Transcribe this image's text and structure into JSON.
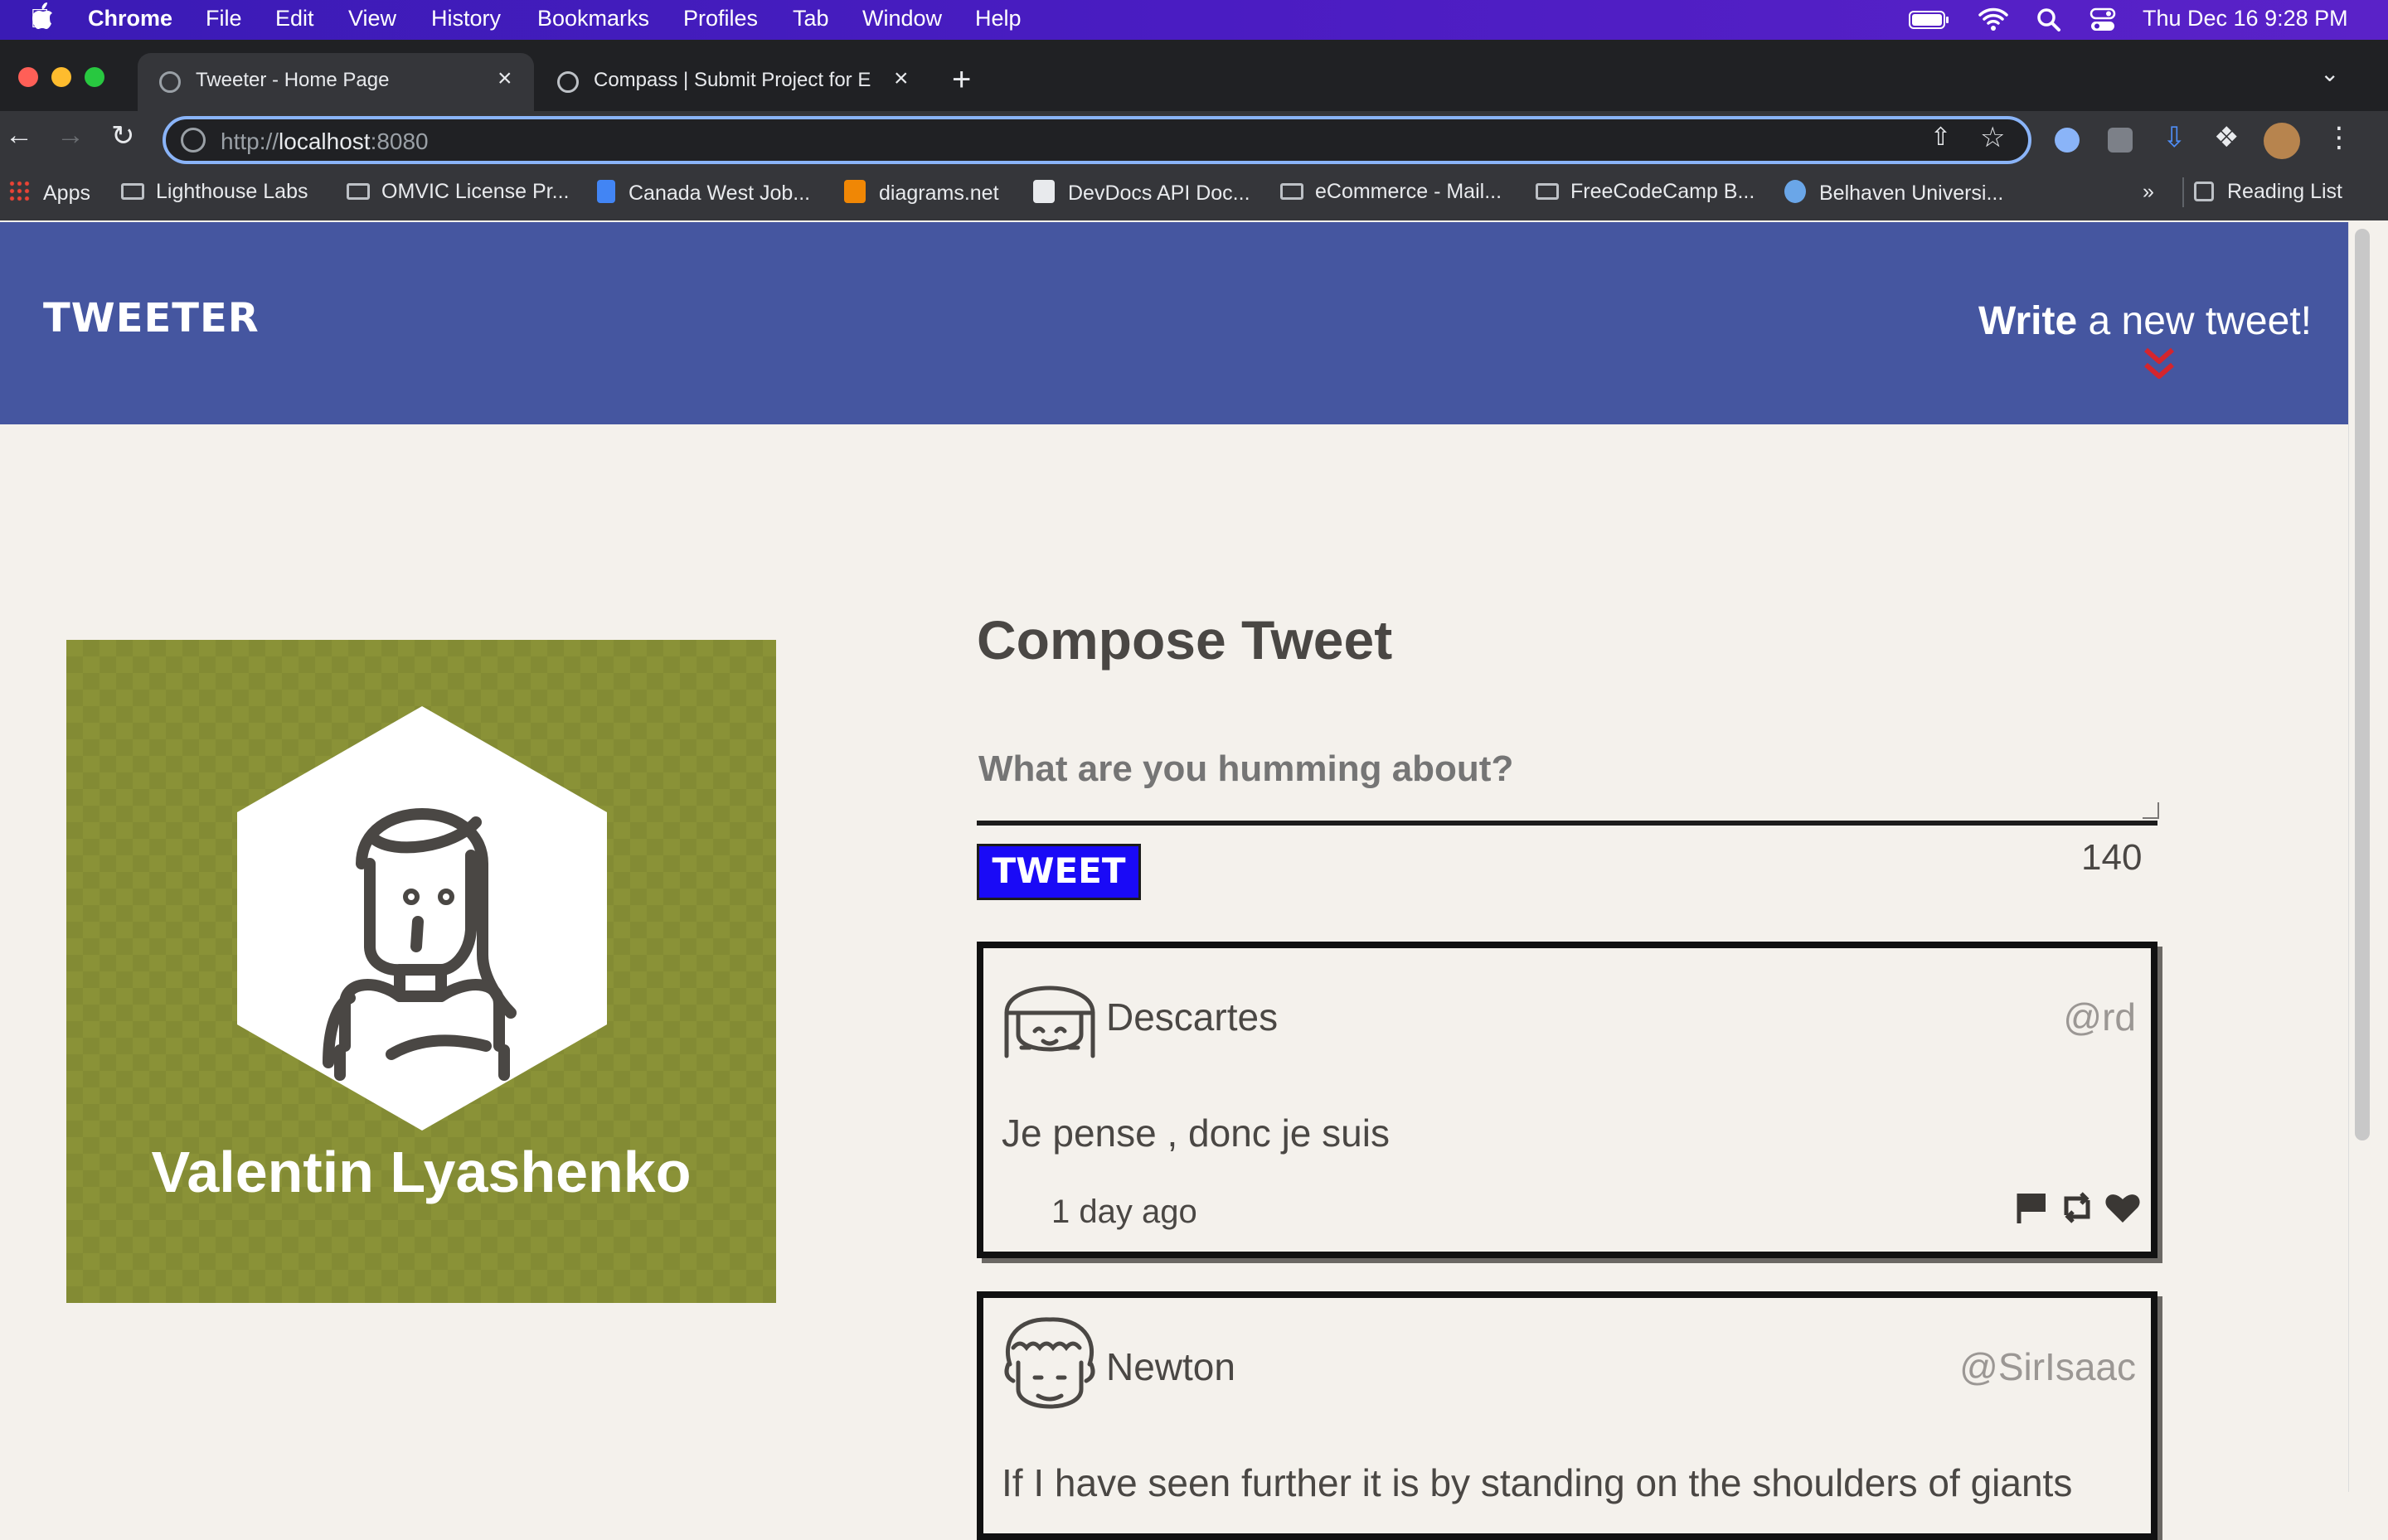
{
  "menubar": {
    "app": "Chrome",
    "items": [
      "File",
      "Edit",
      "View",
      "History",
      "Bookmarks",
      "Profiles",
      "Tab",
      "Window",
      "Help"
    ],
    "datetime": "Thu Dec 16  9:28 PM"
  },
  "tabs": [
    {
      "title": "Tweeter - Home Page",
      "active": true
    },
    {
      "title": "Compass | Submit Project for E",
      "active": false
    }
  ],
  "omnibox": {
    "scheme": "http://",
    "host": "localhost",
    "port": ":8080"
  },
  "bookmarks": [
    {
      "label": "Apps",
      "icon": "apps-grid-icon"
    },
    {
      "label": "Lighthouse Labs",
      "icon": "folder-icon"
    },
    {
      "label": "OMVIC License Pr...",
      "icon": "folder-icon"
    },
    {
      "label": "Canada West Job...",
      "icon": "docs-icon"
    },
    {
      "label": "diagrams.net",
      "icon": "diagrams-icon"
    },
    {
      "label": "DevDocs API Doc...",
      "icon": "devdocs-icon"
    },
    {
      "label": "eCommerce - Mail...",
      "icon": "folder-icon"
    },
    {
      "label": "FreeCodeCamp B...",
      "icon": "folder-icon"
    },
    {
      "label": "Belhaven Universi...",
      "icon": "globe-icon"
    }
  ],
  "bookmarks_overflow": "»",
  "reading_list": "Reading List",
  "site": {
    "brand": "TWEETER",
    "write_bold": "Write",
    "write_rest": " a new tweet!",
    "chevron": "»"
  },
  "profile": {
    "name": "Valentin Lyashenko",
    "bg_color": "#8a9237"
  },
  "compose": {
    "title": "Compose Tweet",
    "placeholder": "What are you humming about?",
    "button": "TWEET",
    "counter": "140"
  },
  "tweets": [
    {
      "name": "Descartes",
      "handle": "@rd",
      "text": "Je pense , donc je suis",
      "age": "1 day ago"
    },
    {
      "name": "Newton",
      "handle": "@SirIsaac",
      "text": "If I have seen further it is by standing on the shoulders of giants",
      "age": ""
    }
  ],
  "colors": {
    "navbar": "#4556a0",
    "page_bg": "#f4f1ec",
    "tweet_button": "#1a0af6",
    "chevron": "#d5252d"
  }
}
